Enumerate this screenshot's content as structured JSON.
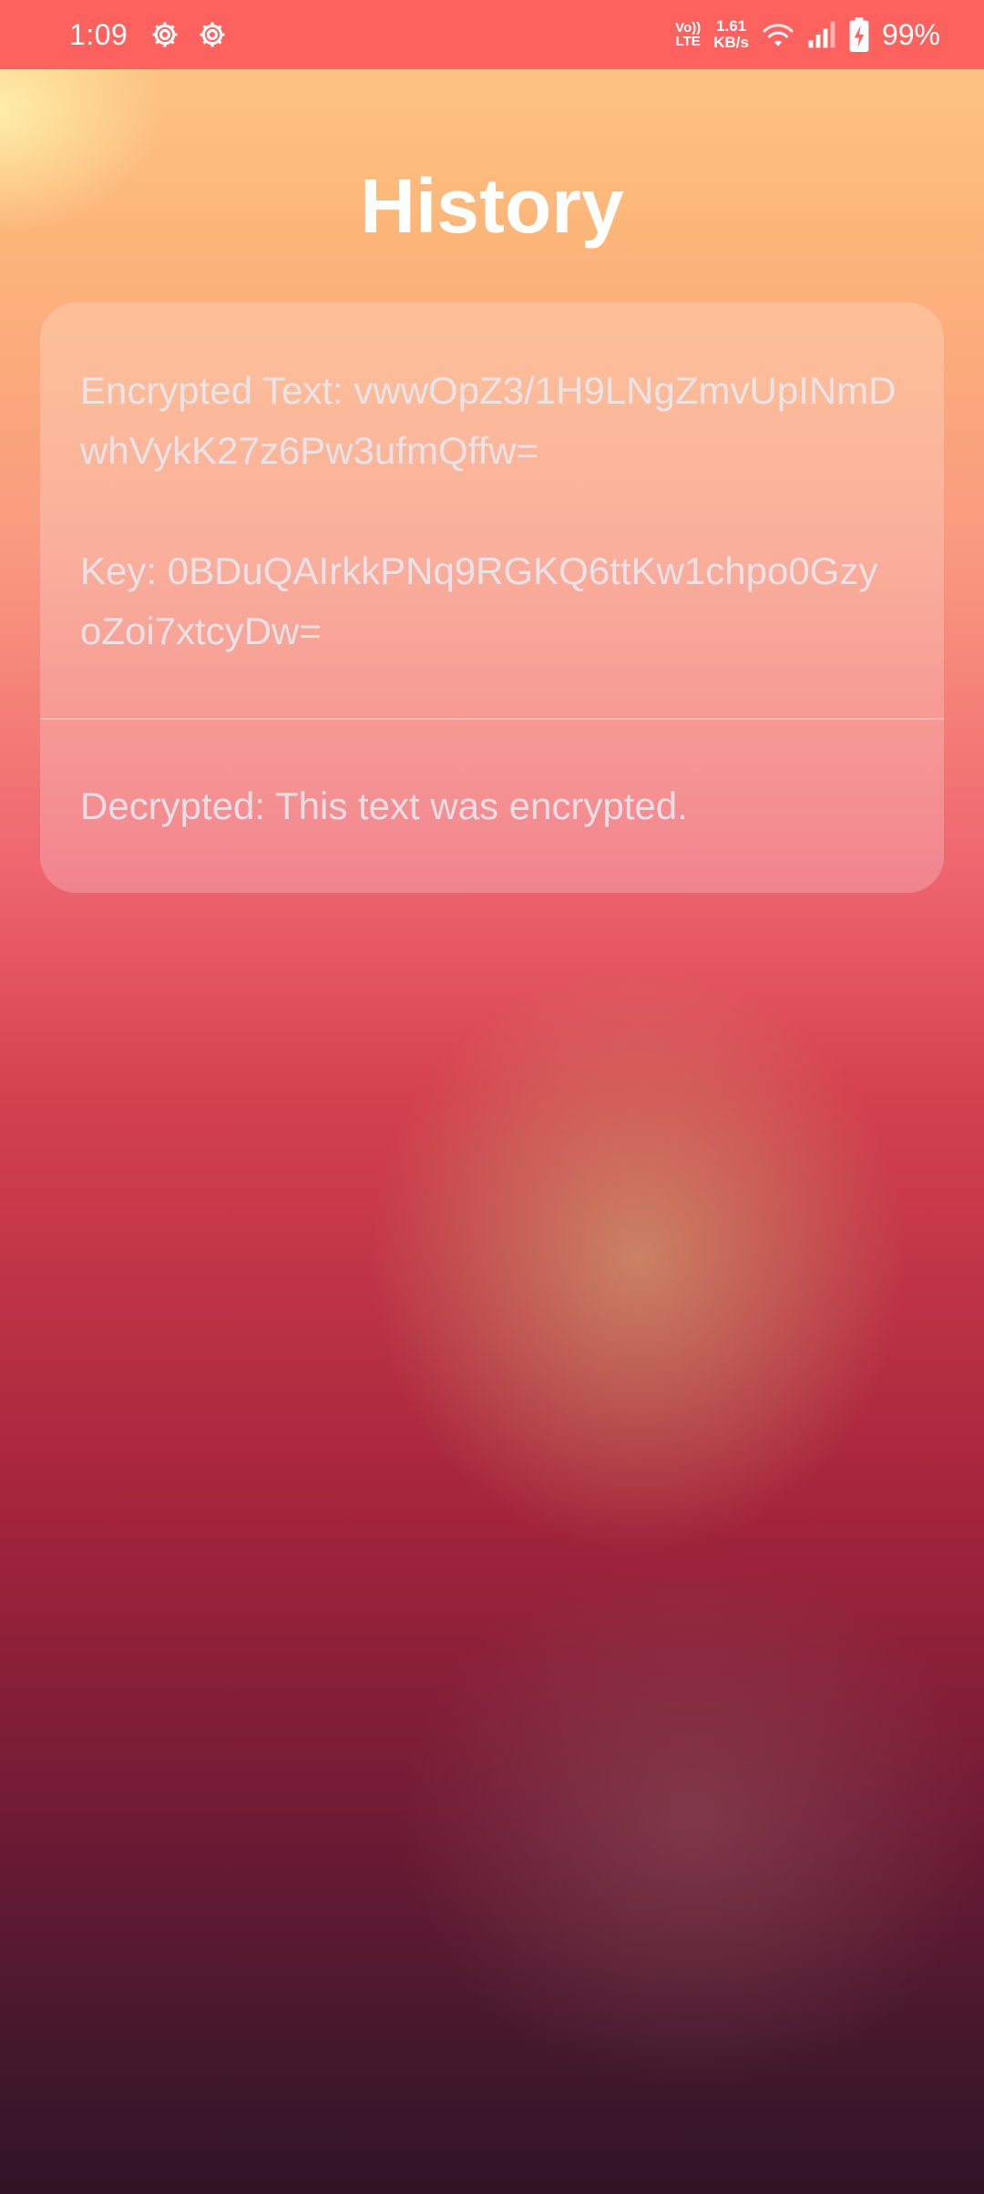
{
  "status_bar": {
    "time": "1:09",
    "icons": [
      "settings-gear-icon",
      "settings-gear-icon",
      "wifi-icon",
      "signal-icon",
      "battery-charging-icon"
    ],
    "volte_top": "Vo))",
    "volte_bottom": "LTE",
    "net_speed_value": "1.61",
    "net_speed_unit": "KB/s",
    "battery": "99%"
  },
  "header": {
    "title": "History"
  },
  "history": [
    {
      "encrypted_text": "Encrypted Text: vwwOpZ3/1H9LNgZmvUpINmDwhVykK27z6Pw3ufmQffw=",
      "key": "Key: 0BDuQAIrkkPNq9RGKQ6ttKw1chpo0GzyoZoi7xtcyDw=",
      "decrypted": "Decrypted: This text was encrypted."
    }
  ],
  "colors": {
    "status_bar": "#fe625f",
    "title": "#ffffff",
    "card_text": "#e8e8f0"
  }
}
